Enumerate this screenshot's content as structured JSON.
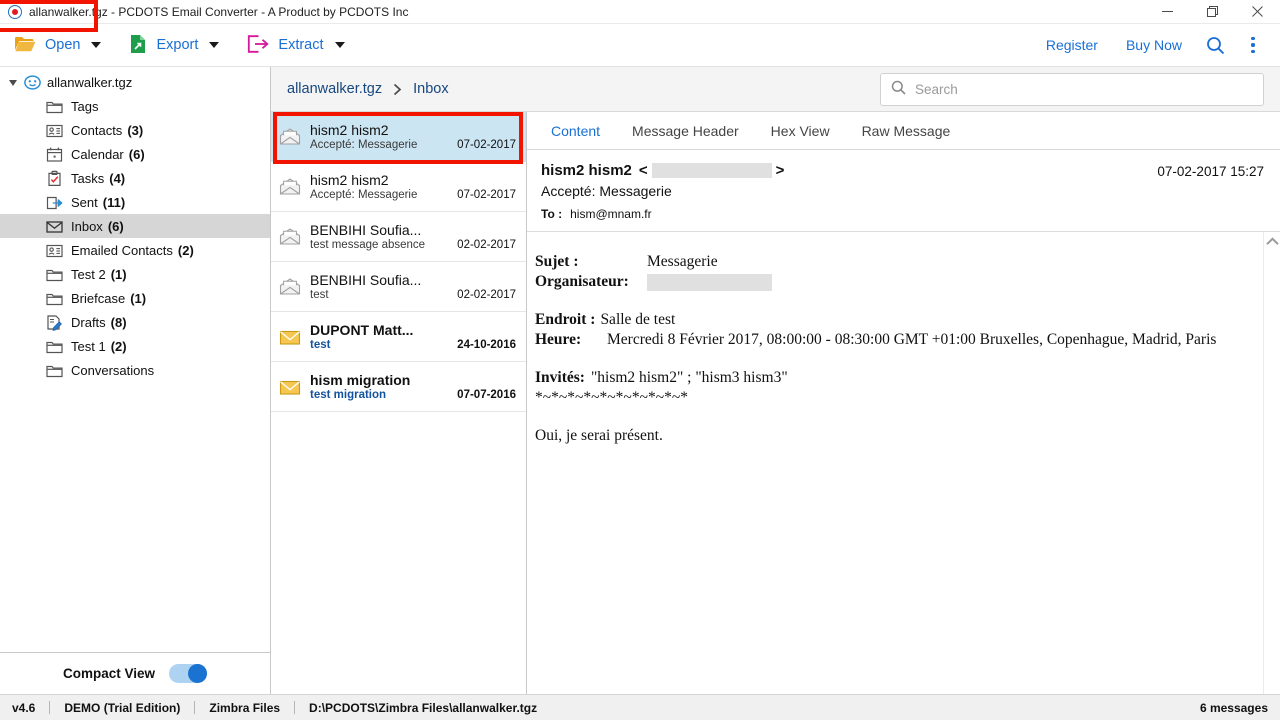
{
  "window": {
    "title": "allanwalker.tgz - PCDOTS Email Converter - A Product by PCDOTS Inc",
    "app_icon": "app-circle-icon",
    "minimize": "minimize-icon",
    "restore": "restore-icon",
    "close": "close-icon"
  },
  "toolbar": {
    "items": [
      {
        "label": "Open",
        "icon": "folder-open-icon",
        "has_caret": true
      },
      {
        "label": "Export",
        "icon": "export-document-icon",
        "has_caret": true
      },
      {
        "label": "Extract",
        "icon": "extract-box-icon",
        "has_caret": true
      }
    ],
    "register_label": "Register",
    "buy_now_label": "Buy Now",
    "search_icon": "search-icon",
    "menu_icon": "kebab-menu-icon"
  },
  "sidebar": {
    "root": {
      "label": "allanwalker.tgz",
      "icon": "archive-icon",
      "expanded": true
    },
    "items": [
      {
        "label": "Tags",
        "count": "",
        "icon": "folder-icon",
        "selected": false
      },
      {
        "label": "Contacts",
        "count": "(3)",
        "icon": "contact-card-icon",
        "selected": false
      },
      {
        "label": "Calendar",
        "count": "(6)",
        "icon": "calendar-icon",
        "selected": false
      },
      {
        "label": "Tasks",
        "count": "(4)",
        "icon": "tasks-icon",
        "selected": false
      },
      {
        "label": "Sent",
        "count": "(11)",
        "icon": "sent-icon",
        "selected": false
      },
      {
        "label": "Inbox",
        "count": "(6)",
        "icon": "inbox-envelope-icon",
        "selected": true
      },
      {
        "label": "Emailed Contacts",
        "count": "(2)",
        "icon": "contact-card-icon",
        "selected": false
      },
      {
        "label": "Test 2",
        "count": "(1)",
        "icon": "folder-icon",
        "selected": false
      },
      {
        "label": "Briefcase",
        "count": "(1)",
        "icon": "folder-icon",
        "selected": false
      },
      {
        "label": "Drafts",
        "count": "(8)",
        "icon": "drafts-pencil-icon",
        "selected": false
      },
      {
        "label": "Test 1",
        "count": "(2)",
        "icon": "folder-icon",
        "selected": false
      },
      {
        "label": "Conversations",
        "count": "",
        "icon": "folder-icon",
        "selected": false
      }
    ],
    "compact_view_label": "Compact View",
    "compact_view_on": true
  },
  "breadcrumb": {
    "root": "allanwalker.tgz",
    "separator": "chevron-right-icon",
    "current": "Inbox"
  },
  "search": {
    "placeholder": "Search",
    "value": "",
    "icon": "search-icon"
  },
  "message_list": {
    "rows": [
      {
        "from": "hism2 hism2",
        "subject": "Accepté: Messagerie",
        "date": "07-02-2017",
        "unread": false,
        "selected": true,
        "icon": "open-envelope-icon"
      },
      {
        "from": "hism2 hism2",
        "subject": "Accepté: Messagerie",
        "date": "07-02-2017",
        "unread": false,
        "selected": false,
        "icon": "open-envelope-icon"
      },
      {
        "from": "BENBIHI Soufia...",
        "subject": "test message absence",
        "date": "02-02-2017",
        "unread": false,
        "selected": false,
        "icon": "open-envelope-icon"
      },
      {
        "from": "BENBIHI Soufia...",
        "subject": "test",
        "date": "02-02-2017",
        "unread": false,
        "selected": false,
        "icon": "open-envelope-icon"
      },
      {
        "from": "DUPONT Matt...",
        "subject": "test",
        "date": "24-10-2016",
        "unread": true,
        "selected": false,
        "icon": "closed-envelope-icon"
      },
      {
        "from": "hism migration",
        "subject": "test migration",
        "date": "07-07-2016",
        "unread": true,
        "selected": false,
        "icon": "closed-envelope-icon"
      }
    ]
  },
  "detail": {
    "tabs": [
      {
        "label": "Content",
        "active": true
      },
      {
        "label": "Message Header",
        "active": false
      },
      {
        "label": "Hex View",
        "active": false
      },
      {
        "label": "Raw Message",
        "active": false
      }
    ],
    "sender_name": "hism2 hism2",
    "angle_open": "<",
    "angle_close": ">",
    "sender_email_redacted": true,
    "subject": "Accepté: Messagerie",
    "to_label": "To :",
    "to_value": "hism@mnam.fr",
    "datetime": "07-02-2017 15:27",
    "body": {
      "sujet_label": "Sujet :",
      "sujet_value": "Messagerie",
      "organisateur_label": "Organisateur:",
      "organisateur_value_redacted": true,
      "endroit_label": "Endroit :",
      "endroit_value": "Salle de test",
      "heure_label": "Heure:",
      "heure_value": "Mercredi 8 Février 2017, 08:00:00 - 08:30:00 GMT +01:00 Bruxelles, Copenhague, Madrid, Paris",
      "invites_label": "Invités:",
      "invites_value": "\"hism2 hism2\" ; \"hism3 hism3\"",
      "divider": "*~*~*~*~*~*~*~*~*~*",
      "reply": "Oui, je serai présent."
    },
    "scroll_up_icon": "chevron-up-icon"
  },
  "statusbar": {
    "version": "v4.6",
    "edition": "DEMO (Trial Edition)",
    "format": "Zimbra Files",
    "path": "D:\\PCDOTS\\Zimbra Files\\allanwalker.tgz",
    "message_count": "6 messages"
  },
  "colors": {
    "accent_blue": "#1a6fd4",
    "breadcrumb_blue": "#17477e",
    "selection_blue": "#cbe5f3",
    "annotation_red": "#f31400",
    "sidebar_selection": "#d6d6d6",
    "toggle_on": "#1a73d0"
  }
}
